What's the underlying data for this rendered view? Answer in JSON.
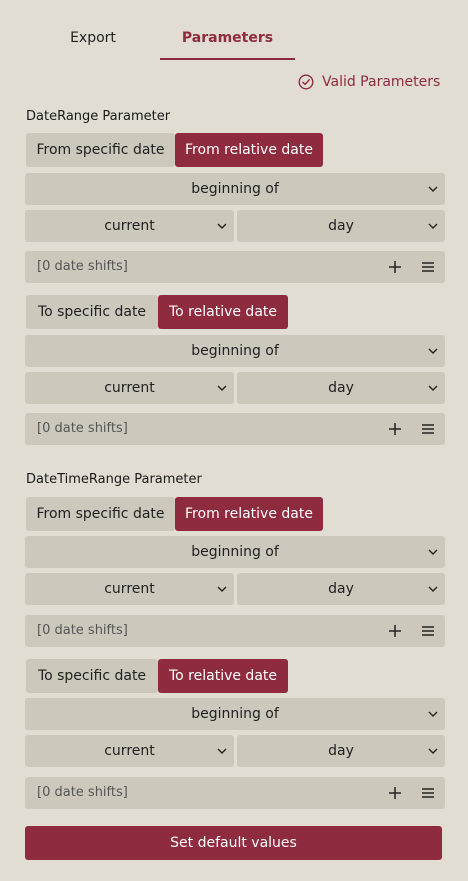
{
  "tabs": [
    {
      "label": "Export",
      "active": false
    },
    {
      "label": "Parameters",
      "active": true
    }
  ],
  "status": {
    "text": "Valid Parameters",
    "icon": "check-circle-icon"
  },
  "colors": {
    "accent": "#8e2b3e",
    "background": "#e1ddd2",
    "control": "#cdc8bc"
  },
  "sections": [
    {
      "title": "DateRange Parameter",
      "from": {
        "specific_label": "From specific date",
        "relative_label": "From relative date",
        "anchor": "beginning of",
        "period": "current",
        "unit": "day",
        "shifts": "[0 date shifts]"
      },
      "to": {
        "specific_label": "To specific date",
        "relative_label": "To relative date",
        "anchor": "beginning of",
        "period": "current",
        "unit": "day",
        "shifts": "[0 date shifts]"
      }
    },
    {
      "title": "DateTimeRange Parameter",
      "from": {
        "specific_label": "From specific date",
        "relative_label": "From relative date",
        "anchor": "beginning of",
        "period": "current",
        "unit": "day",
        "shifts": "[0 date shifts]"
      },
      "to": {
        "specific_label": "To specific date",
        "relative_label": "To relative date",
        "anchor": "beginning of",
        "period": "current",
        "unit": "day",
        "shifts": "[0 date shifts]"
      }
    }
  ],
  "footer": {
    "default_label": "Set default values"
  }
}
